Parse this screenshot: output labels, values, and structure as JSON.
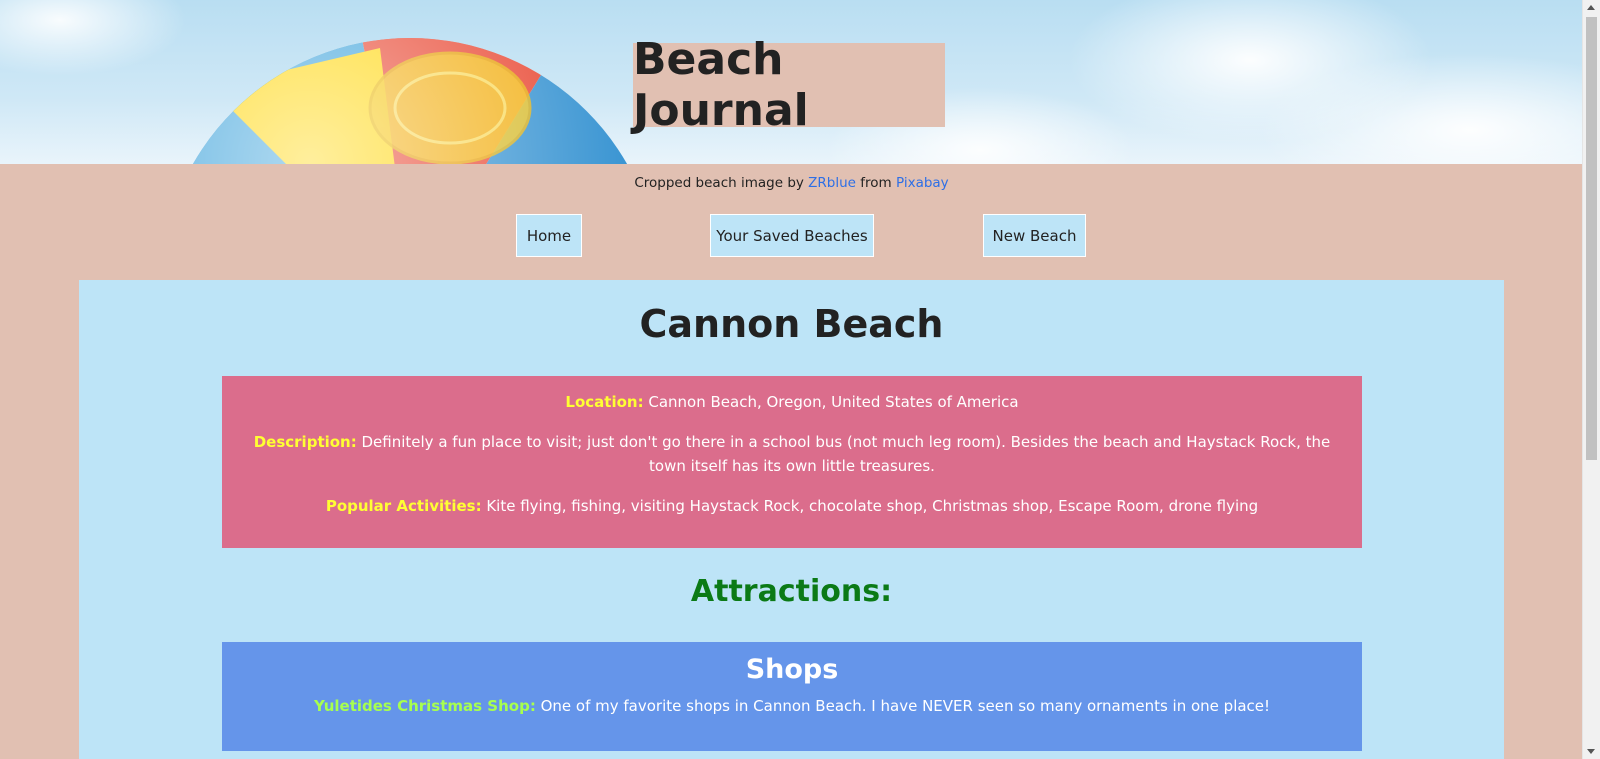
{
  "header": {
    "title": "Beach Journal"
  },
  "credit": {
    "prefix": "Cropped beach image by ",
    "author": "ZRblue",
    "middle": " from ",
    "source": "Pixabay"
  },
  "nav": {
    "home": "Home",
    "saved": "Your Saved Beaches",
    "new": "New Beach"
  },
  "beach": {
    "name": "Cannon Beach",
    "location_label": "Location:",
    "location": " Cannon Beach, Oregon, United States of America",
    "description_label": "Description:",
    "description": " Definitely a fun place to visit; just don't go there in a school bus (not much leg room). Besides the beach and Haystack Rock, the town itself has its own little treasures.",
    "activities_label": "Popular Activities:",
    "activities": " Kite flying, fishing, visiting Haystack Rock, chocolate shop, Christmas shop, Escape Room, drone flying"
  },
  "attractions": {
    "heading": "Attractions:",
    "shops": {
      "heading": "Shops",
      "items": [
        {
          "name": "Yuletides Christmas Shop:",
          "note": " One of my favorite shops in Cannon Beach. I have NEVER seen so many ornaments in one place!"
        }
      ]
    }
  },
  "colors": {
    "page_bg": "#e1c0b2",
    "panel_bg": "#bde4f7",
    "info_bg": "#db6d8c",
    "label_yellow": "#ffff33",
    "attractions_green": "#0b7a16",
    "shops_bg": "#6595ea",
    "shop_label_green": "#a7ff4f",
    "link_blue": "#2e6fe6"
  },
  "icons": {
    "hero_image": "beach-ball-sky",
    "scroll_up": "scroll-up-arrow",
    "scroll_down": "scroll-down-arrow"
  }
}
